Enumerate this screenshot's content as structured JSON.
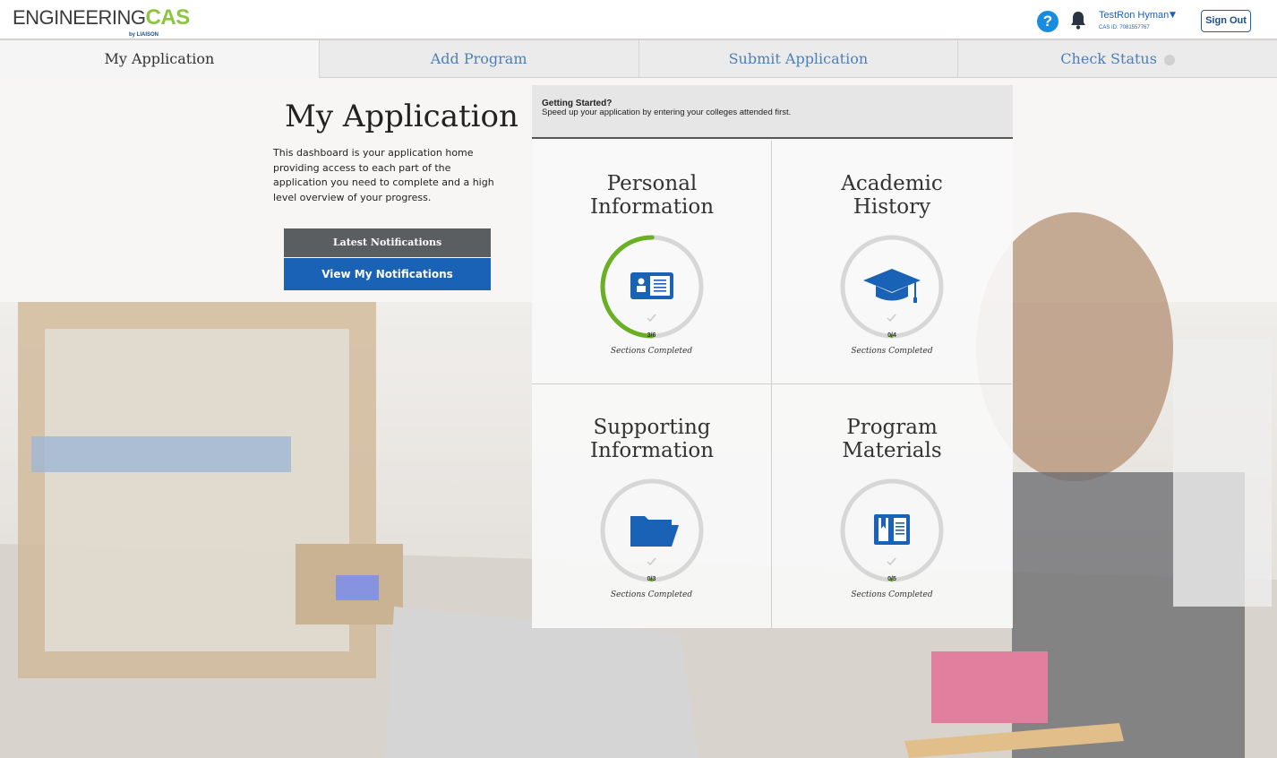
{
  "header": {
    "logo_eng": "ENGINEERING",
    "logo_cas": "CAS",
    "logo_by": "by LIAISON",
    "user_name": "TestRon Hyman",
    "cas_id": "CAS ID: 7081557767",
    "sign_out": "Sign Out"
  },
  "tabs": [
    {
      "label": "My Application"
    },
    {
      "label": "Add Program"
    },
    {
      "label": "Submit Application"
    },
    {
      "label": "Check Status"
    }
  ],
  "intro": {
    "title": "My Application",
    "text": "This dashboard is your application home providing access to each part of the application you need to complete and a high level overview of your progress.",
    "notifications_heading": "Latest Notifications",
    "view_notifications": "View My Notifications"
  },
  "getting_started": {
    "title": "Getting Started?",
    "text": "Speed up your application by entering your colleges attended first."
  },
  "tiles": [
    {
      "title": "Personal Information",
      "completed": 3,
      "total": 6,
      "progress": "3/6",
      "caption": "Sections Completed",
      "icon": "id-card-icon"
    },
    {
      "title": "Academic History",
      "completed": 0,
      "total": 4,
      "progress": "0/4",
      "caption": "Sections Completed",
      "icon": "graduation-cap-icon"
    },
    {
      "title": "Supporting Information",
      "completed": 0,
      "total": 3,
      "progress": "0/3",
      "caption": "Sections Completed",
      "icon": "folder-icon"
    },
    {
      "title": "Program Materials",
      "completed": 0,
      "total": 5,
      "progress": "0/5",
      "caption": "Sections Completed",
      "icon": "book-icon"
    }
  ],
  "colors": {
    "accent": "#1a62b5",
    "progress": "#6ab023",
    "brand_green": "#8cc63f"
  }
}
